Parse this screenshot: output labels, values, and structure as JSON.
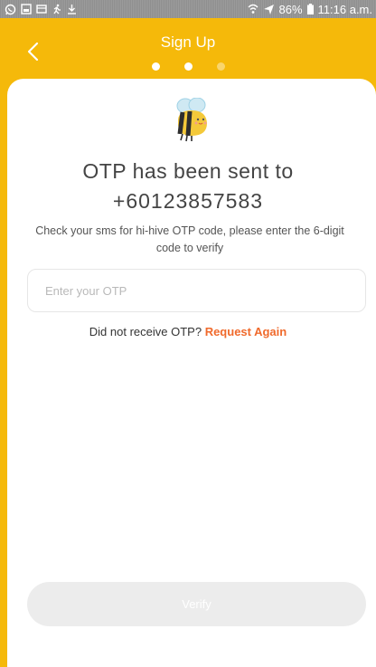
{
  "status_bar": {
    "left_icons": [
      "whatsapp-icon",
      "gallery-icon",
      "screen-icon",
      "run-icon",
      "download-icon"
    ],
    "right_icons": [
      "wifi-icon",
      "airplane-icon"
    ],
    "battery": "86%",
    "time": "11:16 a.m."
  },
  "header": {
    "title": "Sign Up",
    "back_icon": "chevron-left-icon",
    "steps": [
      {
        "state": "active"
      },
      {
        "state": "active"
      },
      {
        "state": "inactive"
      }
    ]
  },
  "main": {
    "mascot_icon": "bee-icon",
    "heading": "OTP has been sent to",
    "phone_number": "+60123857583",
    "description": "Check your sms for hi-hive OTP code, please enter the 6-digit code to verify",
    "otp_input": {
      "placeholder": "Enter your OTP",
      "value": ""
    },
    "resend_prompt": "Did not receive OTP?",
    "resend_link": "Request Again",
    "verify_label": "Verify"
  },
  "colors": {
    "brand": "#f5b90a",
    "link": "#f06a2c",
    "button_disabled": "#ececec"
  }
}
